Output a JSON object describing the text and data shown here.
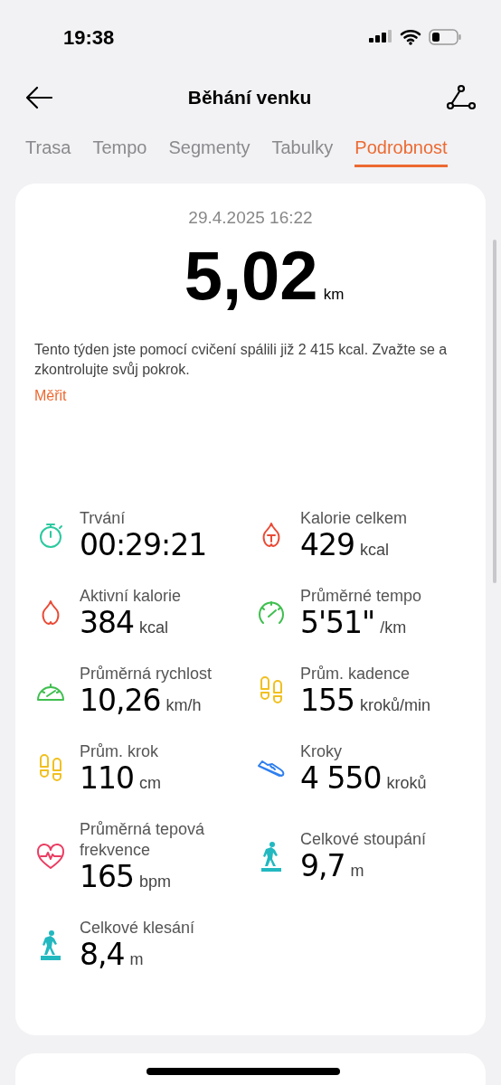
{
  "status_bar": {
    "time": "19:38"
  },
  "header": {
    "title": "Běhání venku"
  },
  "tabs": [
    {
      "label": "Trasa",
      "selected": false
    },
    {
      "label": "Tempo",
      "selected": false
    },
    {
      "label": "Segmenty",
      "selected": false
    },
    {
      "label": "Tabulky",
      "selected": false
    },
    {
      "label": "Podrobnost",
      "selected": true
    }
  ],
  "summary": {
    "date": "29.4.2025 16:22",
    "distance": "5,02",
    "distance_unit": "km",
    "message": "Tento týden jste pomocí cvičení spálili již 2 415 kcal. Zvažte se a zkontrolujte svůj pokrok.",
    "link": "Měřit"
  },
  "metrics": [
    {
      "kind": "stopwatch",
      "label": "Trvání",
      "value": "00:29:21",
      "color": "#2cc9a0"
    },
    {
      "kind": "flame-t",
      "label": "Kalorie celkem",
      "value": "429",
      "unit": "kcal",
      "color": "#ea4a35"
    },
    {
      "kind": "flame",
      "label": "Aktivní kalorie",
      "value": "384",
      "unit": "kcal",
      "color": "#ea4a35"
    },
    {
      "kind": "gauge-open",
      "label": "Průměrné tempo",
      "value": "5'51\"",
      "unit": "/km",
      "color": "#3fbf4f"
    },
    {
      "kind": "gauge",
      "label": "Průměrná rychlost",
      "value": "10,26",
      "unit": "km/h",
      "color": "#3fbf4f"
    },
    {
      "kind": "footprints",
      "label": "Prům. kadence",
      "value": "155",
      "unit": "kroků/min",
      "color": "#f0c020"
    },
    {
      "kind": "footprints",
      "label": "Prům. krok",
      "value": "110",
      "unit": "cm",
      "color": "#f0c020"
    },
    {
      "kind": "shoe",
      "label": "Kroky",
      "value": "4 550",
      "unit": "kroků",
      "color": "#2f7ff0"
    },
    {
      "kind": "heart",
      "label": "Průměrná tepová frekvence",
      "value": "165",
      "unit": "bpm",
      "color": "#ea3e63"
    },
    {
      "kind": "hiker-up",
      "label": "Celkové stoupání",
      "value": "9,7",
      "unit": "m",
      "color": "#22b8c0"
    },
    {
      "kind": "hiker-down",
      "label": "Celkové klesání",
      "value": "8,4",
      "unit": "m",
      "color": "#22b8c0"
    }
  ]
}
